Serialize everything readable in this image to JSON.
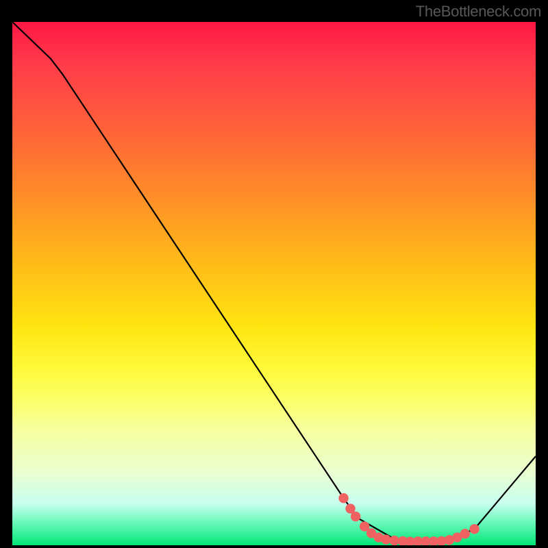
{
  "attribution": "TheBottleneck.com",
  "chart_data": {
    "type": "line",
    "title": "",
    "xlabel": "",
    "ylabel": "",
    "xlim": [
      0,
      100
    ],
    "ylim": [
      0,
      100
    ],
    "curve_points": [
      {
        "x": 0,
        "y": 100
      },
      {
        "x": 7.3,
        "y": 93
      },
      {
        "x": 9.6,
        "y": 90
      },
      {
        "x": 63.3,
        "y": 9
      },
      {
        "x": 66,
        "y": 5.2
      },
      {
        "x": 73.7,
        "y": 0.8
      },
      {
        "x": 82.6,
        "y": 0.6
      },
      {
        "x": 88.3,
        "y": 3.1
      },
      {
        "x": 100,
        "y": 17
      }
    ],
    "marker_points": [
      {
        "x": 63.3,
        "y": 9.0
      },
      {
        "x": 64.6,
        "y": 7.0
      },
      {
        "x": 65.6,
        "y": 5.5
      },
      {
        "x": 67.3,
        "y": 3.6
      },
      {
        "x": 68.6,
        "y": 2.3
      },
      {
        "x": 70.0,
        "y": 1.5
      },
      {
        "x": 71.4,
        "y": 1.1
      },
      {
        "x": 73.0,
        "y": 0.9
      },
      {
        "x": 74.6,
        "y": 0.8
      },
      {
        "x": 76.0,
        "y": 0.7
      },
      {
        "x": 77.5,
        "y": 0.75
      },
      {
        "x": 79.0,
        "y": 0.75
      },
      {
        "x": 80.5,
        "y": 0.75
      },
      {
        "x": 82.0,
        "y": 0.8
      },
      {
        "x": 83.5,
        "y": 1.0
      },
      {
        "x": 85.0,
        "y": 1.5
      },
      {
        "x": 86.5,
        "y": 2.2
      },
      {
        "x": 88.3,
        "y": 3.1
      }
    ],
    "marker_color": "#f06262",
    "line_color": "#000000"
  }
}
